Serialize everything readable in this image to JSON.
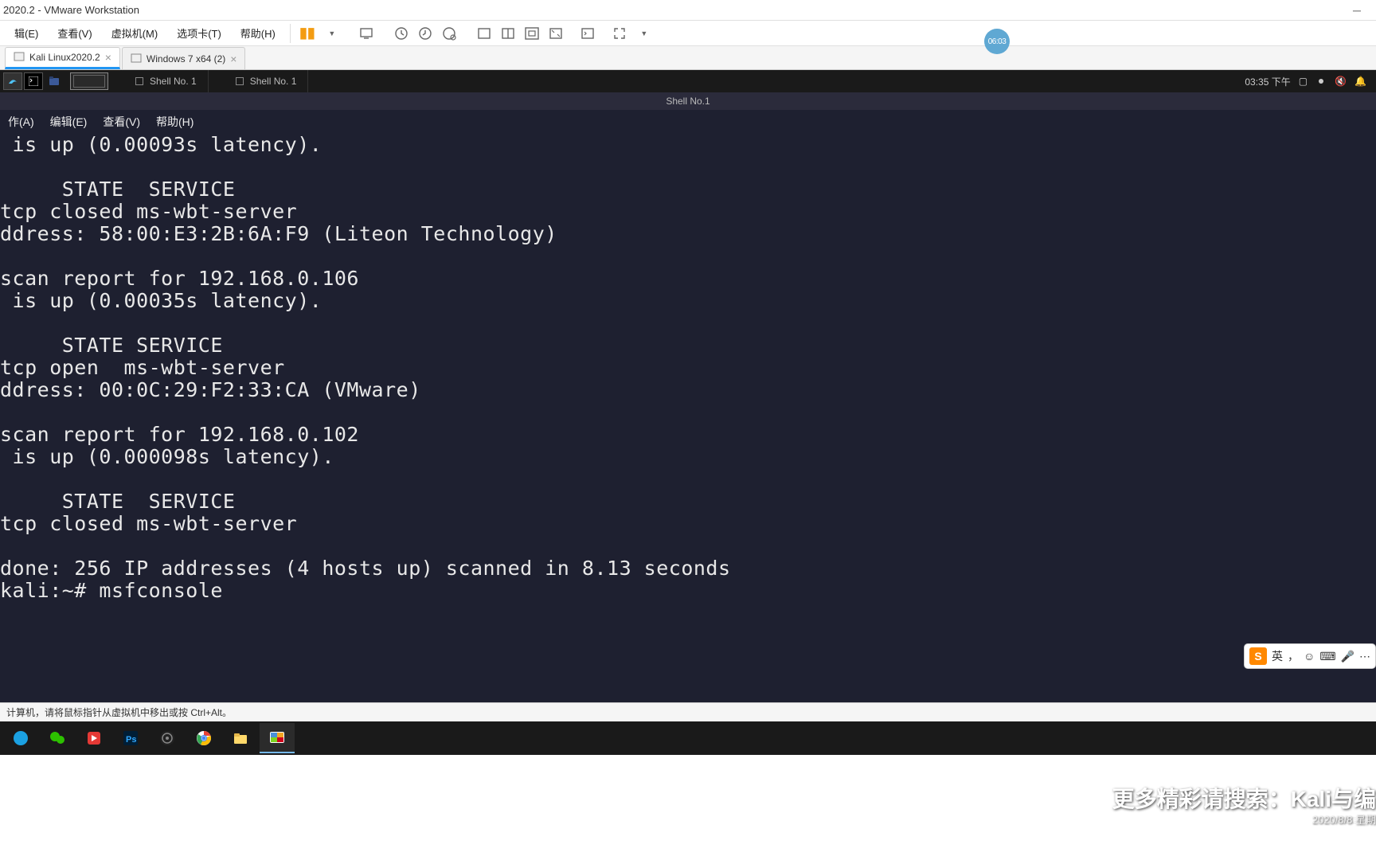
{
  "title_bar": {
    "title": "2020.2 - VMware Workstation"
  },
  "menu_bar": {
    "items": [
      "辑(E)",
      "查看(V)",
      "虚拟机(M)",
      "选项卡(T)",
      "帮助(H)"
    ]
  },
  "vm_tabs": {
    "active": "Kali Linux2020.2",
    "inactive": "Windows 7 x64 (2)"
  },
  "kali_bar": {
    "shell1": "Shell No. 1",
    "shell2": "Shell No. 1",
    "time": "03:35 下午"
  },
  "kali_title": "Shell No.1",
  "term_menu": {
    "items": [
      "作(A)",
      "编辑(E)",
      "查看(V)",
      "帮助(H)"
    ]
  },
  "terminal_content": " is up (0.00093s latency).\n\n     STATE  SERVICE\ntcp closed ms-wbt-server\nddress: 58:00:E3:2B:6A:F9 (Liteon Technology)\n\nscan report for 192.168.0.106\n is up (0.00035s latency).\n\n     STATE SERVICE\ntcp open  ms-wbt-server\nddress: 00:0C:29:F2:33:CA (VMware)\n\nscan report for 192.168.0.102\n is up (0.000098s latency).\n\n     STATE  SERVICE\ntcp closed ms-wbt-server\n\ndone: 256 IP addresses (4 hosts up) scanned in 8.13 seconds\nkali:~# msfconsole",
  "vm_status": "计算机，请将鼠标指针从虚拟机中移出或按 Ctrl+Alt。",
  "pill_time": "06:03",
  "ime": {
    "lang": "英"
  },
  "overlay": {
    "search_text": "更多精彩请搜索：Kali与编",
    "date": "2020/8/8 星期"
  }
}
